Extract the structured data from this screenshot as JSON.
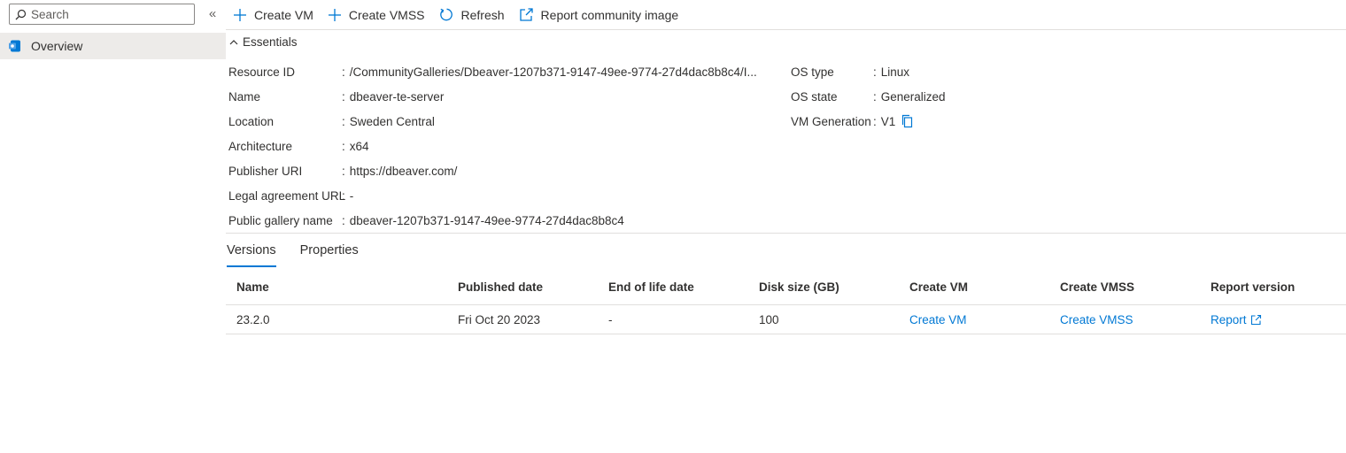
{
  "sidebar": {
    "search_placeholder": "Search",
    "collapse_glyph": "«",
    "items": [
      {
        "label": "Overview",
        "icon": "overview-icon",
        "selected": true
      }
    ]
  },
  "toolbar": {
    "buttons": [
      {
        "label": "Create VM",
        "icon": "plus-icon"
      },
      {
        "label": "Create VMSS",
        "icon": "plus-icon"
      },
      {
        "label": "Refresh",
        "icon": "refresh-icon"
      },
      {
        "label": "Report community image",
        "icon": "external-link-icon"
      }
    ]
  },
  "essentials": {
    "title": "Essentials",
    "left": [
      {
        "key": "Resource ID",
        "value": "/CommunityGalleries/Dbeaver-1207b371-9147-49ee-9774-27d4dac8b8c4/I..."
      },
      {
        "key": "Name",
        "value": "dbeaver-te-server"
      },
      {
        "key": "Location",
        "value": "Sweden Central"
      },
      {
        "key": "Architecture",
        "value": "x64"
      },
      {
        "key": "Publisher URI",
        "value": "https://dbeaver.com/"
      },
      {
        "key": "Legal agreement URL",
        "value": "-"
      },
      {
        "key": "Public gallery name",
        "value": "dbeaver-1207b371-9147-49ee-9774-27d4dac8b8c4"
      }
    ],
    "right": [
      {
        "key": "OS type",
        "value": "Linux"
      },
      {
        "key": "OS state",
        "value": "Generalized"
      },
      {
        "key": "VM Generation",
        "value": "V1"
      }
    ]
  },
  "tabs": [
    {
      "label": "Versions",
      "active": true
    },
    {
      "label": "Properties",
      "active": false
    }
  ],
  "table": {
    "columns": [
      "Name",
      "Published date",
      "End of life date",
      "Disk size (GB)",
      "Create VM",
      "Create VMSS",
      "Report version"
    ],
    "rows": [
      {
        "name": "23.2.0",
        "published": "Fri Oct 20 2023",
        "eol": "-",
        "disk": "100",
        "create_vm": "Create VM",
        "create_vmss": "Create VMSS",
        "report": "Report"
      }
    ]
  },
  "colors": {
    "accent": "#0078d4",
    "text": "#323130",
    "border": "#e1dfdd",
    "selected_bg": "#edebe9"
  }
}
